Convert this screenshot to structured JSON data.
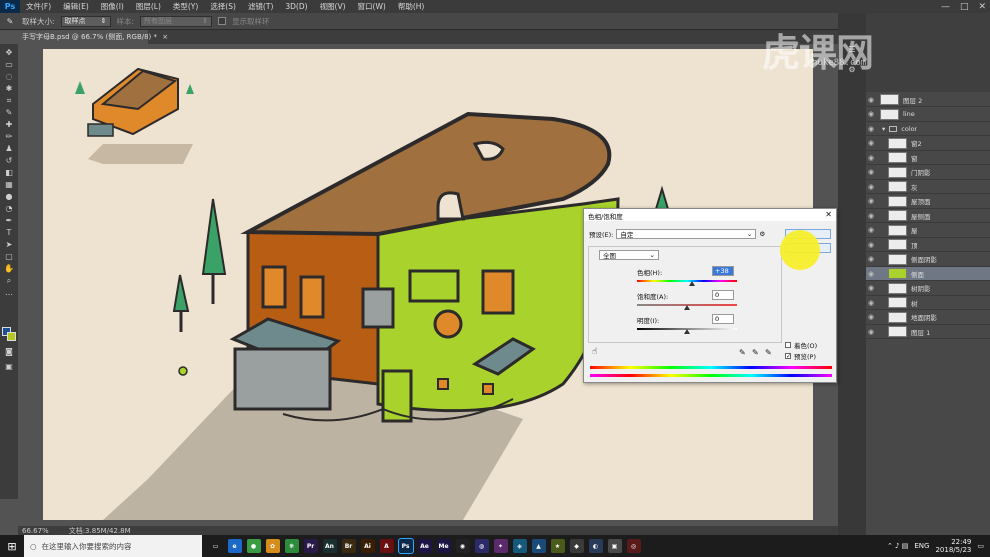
{
  "menubar": {
    "logo": "Ps",
    "items": [
      "文件(F)",
      "编辑(E)",
      "图像(I)",
      "图层(L)",
      "类型(Y)",
      "选择(S)",
      "滤镜(T)",
      "3D(D)",
      "视图(V)",
      "窗口(W)",
      "帮助(H)"
    ],
    "window_controls": [
      "—",
      "□",
      "✕"
    ]
  },
  "options_bar": {
    "sample_size_label": "取样大小:",
    "sample_size_value": "取样点",
    "sample_label": "样本:",
    "sample_value": "所有图层",
    "show_ring_label": "显示取样环"
  },
  "document": {
    "tab_title": "手写字母B.psd @ 66.7% (侧面, RGB/8) *",
    "close_icon": "×"
  },
  "status_bar": {
    "zoom": "66.67%",
    "doc_size": "文档:3.85M/42.8M"
  },
  "watermark": {
    "logo_text": "虎课网",
    "site": "huke88.com"
  },
  "layers": [
    {
      "name": "图层 2",
      "type": "layer"
    },
    {
      "name": "line",
      "type": "layer"
    },
    {
      "name": "color",
      "type": "group"
    },
    {
      "name": "窗2",
      "type": "layer"
    },
    {
      "name": "窗",
      "type": "layer"
    },
    {
      "name": "门阴影",
      "type": "layer"
    },
    {
      "name": "灰",
      "type": "layer"
    },
    {
      "name": "屋顶面",
      "type": "layer"
    },
    {
      "name": "屋侧面",
      "type": "layer"
    },
    {
      "name": "屋",
      "type": "layer"
    },
    {
      "name": "顶",
      "type": "layer"
    },
    {
      "name": "侧面阴影",
      "type": "layer"
    },
    {
      "name": "侧面",
      "type": "layer",
      "selected": true
    },
    {
      "name": "树阴影",
      "type": "layer"
    },
    {
      "name": "树",
      "type": "layer"
    },
    {
      "name": "地面阴影",
      "type": "layer"
    },
    {
      "name": "图层 1",
      "type": "layer"
    }
  ],
  "dialog": {
    "title": "色相/饱和度",
    "preset_label": "预设(E):",
    "preset_value": "自定",
    "channel_value": "全图",
    "hue_label": "色相(H):",
    "hue_value": "+38",
    "saturation_label": "饱和度(A):",
    "saturation_value": "0",
    "lightness_label": "明度(I):",
    "lightness_value": "0",
    "colorize_label": "着色(O)",
    "preview_label": "预览(P)",
    "colorize_checked": false,
    "preview_checked": true,
    "hue_fraction": 0.55,
    "saturation_fraction": 0.5,
    "lightness_fraction": 0.5
  },
  "taskbar": {
    "search_placeholder": "在这里输入你要搜索的内容",
    "apps": [
      {
        "icon": "task-view-icon",
        "label": "▭",
        "color": "#1c1c1c"
      },
      {
        "icon": "edge-icon",
        "label": "e",
        "color": "#1b6ac9"
      },
      {
        "icon": "chrome-icon",
        "label": "●",
        "color": "#3a9d45"
      },
      {
        "icon": "app-icon",
        "label": "✿",
        "color": "#d58d1b"
      },
      {
        "icon": "app-icon",
        "label": "❋",
        "color": "#2d8c3c"
      },
      {
        "icon": "premiere-icon",
        "label": "Pr",
        "color": "#2a1a4a"
      },
      {
        "icon": "animate-icon",
        "label": "An",
        "color": "#1a2f2f"
      },
      {
        "icon": "bridge-icon",
        "label": "Br",
        "color": "#3a2a12"
      },
      {
        "icon": "illustrator-icon",
        "label": "Ai",
        "color": "#3a1f05"
      },
      {
        "icon": "acrobat-icon",
        "label": "A",
        "color": "#6a0f0f"
      },
      {
        "icon": "photoshop-icon",
        "label": "Ps",
        "color": "#0b2a4a"
      },
      {
        "icon": "aftereffects-icon",
        "label": "Ae",
        "color": "#1f1545"
      },
      {
        "icon": "media-encoder-icon",
        "label": "Me",
        "color": "#1f1545"
      },
      {
        "icon": "app-icon",
        "label": "◉",
        "color": "#222"
      },
      {
        "icon": "app-icon",
        "label": "◍",
        "color": "#2b2b6a"
      },
      {
        "icon": "app-icon",
        "label": "✦",
        "color": "#5a2a6a"
      },
      {
        "icon": "app-icon",
        "label": "◈",
        "color": "#155a7a"
      },
      {
        "icon": "app-icon",
        "label": "▲",
        "color": "#1a4a7a"
      },
      {
        "icon": "app-icon",
        "label": "★",
        "color": "#4a5a1a"
      },
      {
        "icon": "app-icon",
        "label": "◆",
        "color": "#3a3a3a"
      },
      {
        "icon": "app-icon",
        "label": "◐",
        "color": "#2a3a5a"
      },
      {
        "icon": "app-icon",
        "label": "▣",
        "color": "#4a4a4a"
      },
      {
        "icon": "app-icon",
        "label": "◎",
        "color": "#5a1a1a"
      }
    ],
    "ime": "ENG",
    "time": "22:49",
    "date": "2018/5/23"
  },
  "colors": {
    "canvas_bg": "#eee3d1",
    "roof": "#a0703f",
    "side_orange": "#b85e14",
    "side_green": "#a9d22c",
    "outline": "#2c2a2a",
    "tree": "#3aa267",
    "awning": "#6e8a8c"
  }
}
